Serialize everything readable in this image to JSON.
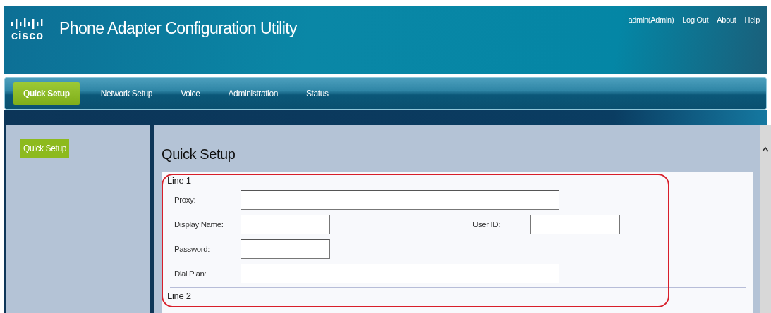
{
  "logo": {
    "wordmark": "cisco"
  },
  "app_title": "Phone Adapter Configuration Utility",
  "user_links": [
    "admin(Admin)",
    "Log Out",
    "About",
    "Help"
  ],
  "tabs": [
    {
      "label": "Quick Setup",
      "selected": true
    },
    {
      "label": "Network Setup",
      "selected": false
    },
    {
      "label": "Voice",
      "selected": false
    },
    {
      "label": "Administration",
      "selected": false
    },
    {
      "label": "Status",
      "selected": false
    }
  ],
  "sidebar": {
    "items": [
      {
        "label": "Quick Setup",
        "selected": true
      }
    ]
  },
  "page_title": "Quick Setup",
  "sections": [
    {
      "title": "Line 1",
      "rows": [
        {
          "fields": [
            {
              "label": "Proxy:",
              "kind": "wide"
            }
          ]
        },
        {
          "fields": [
            {
              "label": "Display Name:",
              "kind": "short"
            },
            {
              "label": "User ID:",
              "kind": "short"
            }
          ]
        },
        {
          "fields": [
            {
              "label": "Password:",
              "kind": "short"
            }
          ]
        },
        {
          "fields": [
            {
              "label": "Dial Plan:",
              "kind": "wide"
            }
          ]
        }
      ]
    },
    {
      "title": "Line 2"
    }
  ]
}
